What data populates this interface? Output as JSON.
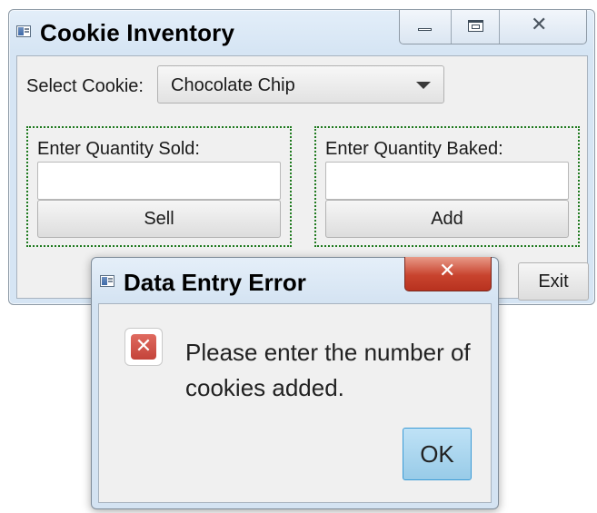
{
  "main_window": {
    "title": "Cookie Inventory",
    "select_label": "Select Cookie:",
    "selected_cookie": "Chocolate Chip",
    "sold_label": "Enter Quantity Sold:",
    "sold_value": "",
    "sell_button": "Sell",
    "baked_label": "Enter Quantity Baked:",
    "baked_value": "",
    "add_button": "Add",
    "exit_button": "Exit"
  },
  "dialog": {
    "title": "Data Entry Error",
    "message": "Please enter the number of cookies added.",
    "ok_button": "OK"
  },
  "icons": {
    "app": "app-window-icon",
    "minimize": "minimize-icon",
    "maximize": "maximize-icon",
    "close": "close-icon",
    "error": "error-icon",
    "dropdown": "chevron-down-icon"
  }
}
